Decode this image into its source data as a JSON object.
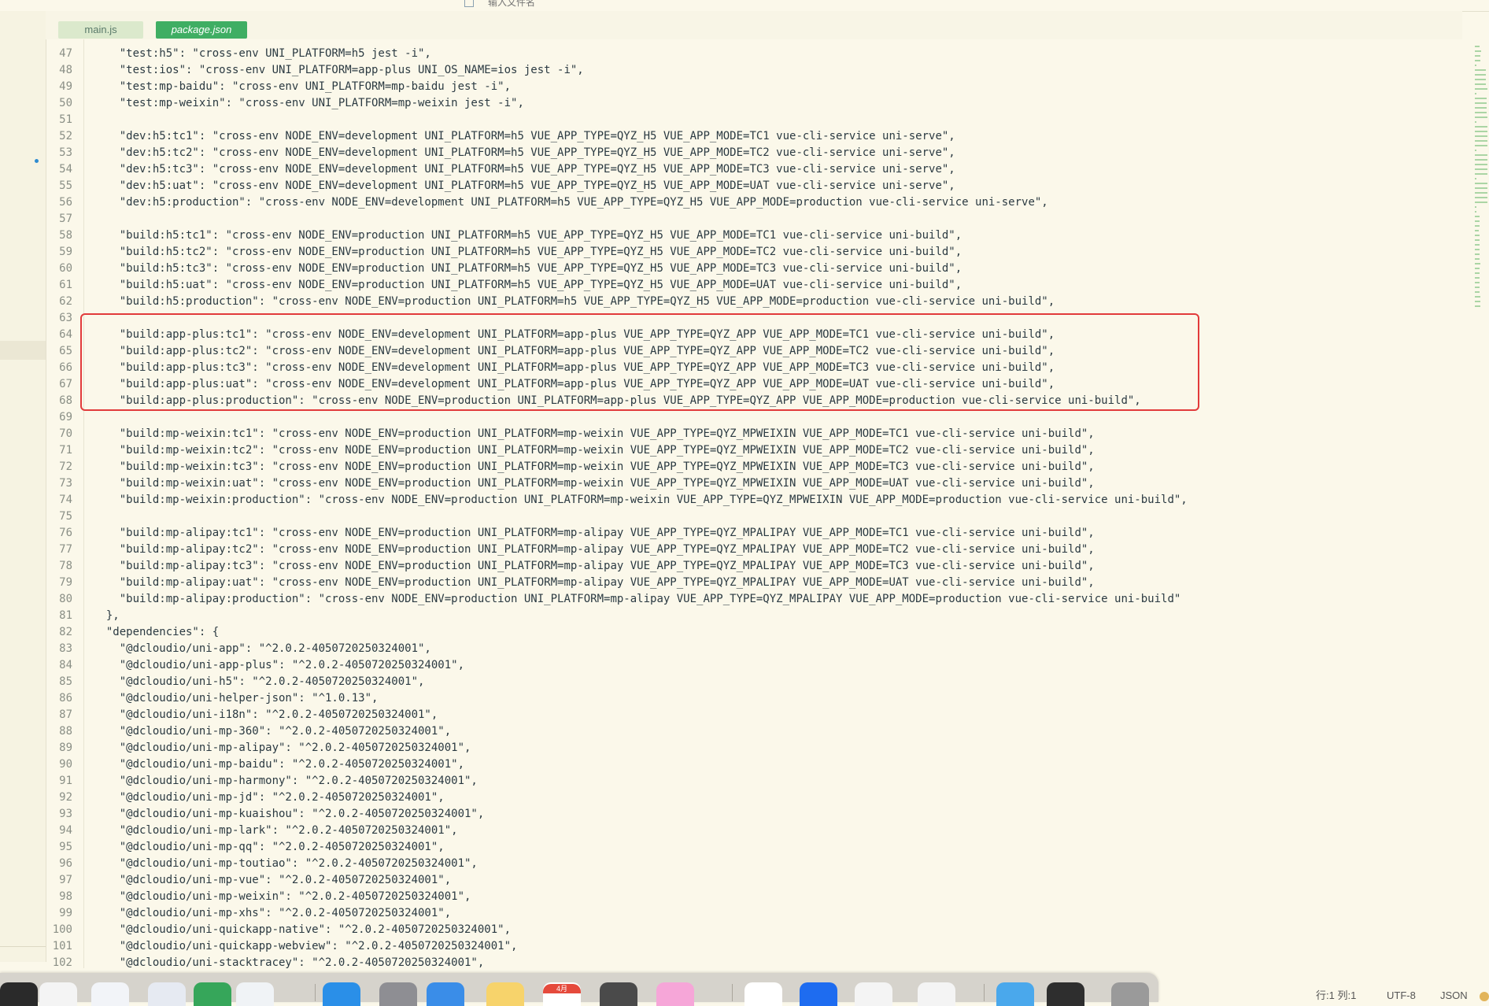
{
  "search": {
    "placeholder": "输入文件名"
  },
  "tabs": [
    {
      "label": "main.js",
      "active": false
    },
    {
      "label": "package.json",
      "active": true
    }
  ],
  "code_lines": [
    {
      "n": "47",
      "text": "    \"test:h5\": \"cross-env UNI_PLATFORM=h5 jest -i\","
    },
    {
      "n": "48",
      "text": "    \"test:ios\": \"cross-env UNI_PLATFORM=app-plus UNI_OS_NAME=ios jest -i\","
    },
    {
      "n": "49",
      "text": "    \"test:mp-baidu\": \"cross-env UNI_PLATFORM=mp-baidu jest -i\","
    },
    {
      "n": "50",
      "text": "    \"test:mp-weixin\": \"cross-env UNI_PLATFORM=mp-weixin jest -i\","
    },
    {
      "n": "51",
      "text": ""
    },
    {
      "n": "52",
      "text": "    \"dev:h5:tc1\": \"cross-env NODE_ENV=development UNI_PLATFORM=h5 VUE_APP_TYPE=QYZ_H5 VUE_APP_MODE=TC1 vue-cli-service uni-serve\","
    },
    {
      "n": "53",
      "text": "    \"dev:h5:tc2\": \"cross-env NODE_ENV=development UNI_PLATFORM=h5 VUE_APP_TYPE=QYZ_H5 VUE_APP_MODE=TC2 vue-cli-service uni-serve\","
    },
    {
      "n": "54",
      "text": "    \"dev:h5:tc3\": \"cross-env NODE_ENV=development UNI_PLATFORM=h5 VUE_APP_TYPE=QYZ_H5 VUE_APP_MODE=TC3 vue-cli-service uni-serve\","
    },
    {
      "n": "55",
      "text": "    \"dev:h5:uat\": \"cross-env NODE_ENV=development UNI_PLATFORM=h5 VUE_APP_TYPE=QYZ_H5 VUE_APP_MODE=UAT vue-cli-service uni-serve\","
    },
    {
      "n": "56",
      "text": "    \"dev:h5:production\": \"cross-env NODE_ENV=development UNI_PLATFORM=h5 VUE_APP_TYPE=QYZ_H5 VUE_APP_MODE=production vue-cli-service uni-serve\","
    },
    {
      "n": "57",
      "text": ""
    },
    {
      "n": "58",
      "text": "    \"build:h5:tc1\": \"cross-env NODE_ENV=production UNI_PLATFORM=h5 VUE_APP_TYPE=QYZ_H5 VUE_APP_MODE=TC1 vue-cli-service uni-build\","
    },
    {
      "n": "59",
      "text": "    \"build:h5:tc2\": \"cross-env NODE_ENV=production UNI_PLATFORM=h5 VUE_APP_TYPE=QYZ_H5 VUE_APP_MODE=TC2 vue-cli-service uni-build\","
    },
    {
      "n": "60",
      "text": "    \"build:h5:tc3\": \"cross-env NODE_ENV=production UNI_PLATFORM=h5 VUE_APP_TYPE=QYZ_H5 VUE_APP_MODE=TC3 vue-cli-service uni-build\","
    },
    {
      "n": "61",
      "text": "    \"build:h5:uat\": \"cross-env NODE_ENV=production UNI_PLATFORM=h5 VUE_APP_TYPE=QYZ_H5 VUE_APP_MODE=UAT vue-cli-service uni-build\","
    },
    {
      "n": "62",
      "text": "    \"build:h5:production\": \"cross-env NODE_ENV=production UNI_PLATFORM=h5 VUE_APP_TYPE=QYZ_H5 VUE_APP_MODE=production vue-cli-service uni-build\","
    },
    {
      "n": "63",
      "text": ""
    },
    {
      "n": "64",
      "text": "    \"build:app-plus:tc1\": \"cross-env NODE_ENV=development UNI_PLATFORM=app-plus VUE_APP_TYPE=QYZ_APP VUE_APP_MODE=TC1 vue-cli-service uni-build\","
    },
    {
      "n": "65",
      "text": "    \"build:app-plus:tc2\": \"cross-env NODE_ENV=development UNI_PLATFORM=app-plus VUE_APP_TYPE=QYZ_APP VUE_APP_MODE=TC2 vue-cli-service uni-build\","
    },
    {
      "n": "66",
      "text": "    \"build:app-plus:tc3\": \"cross-env NODE_ENV=development UNI_PLATFORM=app-plus VUE_APP_TYPE=QYZ_APP VUE_APP_MODE=TC3 vue-cli-service uni-build\","
    },
    {
      "n": "67",
      "text": "    \"build:app-plus:uat\": \"cross-env NODE_ENV=development UNI_PLATFORM=app-plus VUE_APP_TYPE=QYZ_APP VUE_APP_MODE=UAT vue-cli-service uni-build\","
    },
    {
      "n": "68",
      "text": "    \"build:app-plus:production\": \"cross-env NODE_ENV=production UNI_PLATFORM=app-plus VUE_APP_TYPE=QYZ_APP VUE_APP_MODE=production vue-cli-service uni-build\","
    },
    {
      "n": "69",
      "text": ""
    },
    {
      "n": "70",
      "text": "    \"build:mp-weixin:tc1\": \"cross-env NODE_ENV=production UNI_PLATFORM=mp-weixin VUE_APP_TYPE=QYZ_MPWEIXIN VUE_APP_MODE=TC1 vue-cli-service uni-build\","
    },
    {
      "n": "71",
      "text": "    \"build:mp-weixin:tc2\": \"cross-env NODE_ENV=production UNI_PLATFORM=mp-weixin VUE_APP_TYPE=QYZ_MPWEIXIN VUE_APP_MODE=TC2 vue-cli-service uni-build\","
    },
    {
      "n": "72",
      "text": "    \"build:mp-weixin:tc3\": \"cross-env NODE_ENV=production UNI_PLATFORM=mp-weixin VUE_APP_TYPE=QYZ_MPWEIXIN VUE_APP_MODE=TC3 vue-cli-service uni-build\","
    },
    {
      "n": "73",
      "text": "    \"build:mp-weixin:uat\": \"cross-env NODE_ENV=production UNI_PLATFORM=mp-weixin VUE_APP_TYPE=QYZ_MPWEIXIN VUE_APP_MODE=UAT vue-cli-service uni-build\","
    },
    {
      "n": "74",
      "text": "    \"build:mp-weixin:production\": \"cross-env NODE_ENV=production UNI_PLATFORM=mp-weixin VUE_APP_TYPE=QYZ_MPWEIXIN VUE_APP_MODE=production vue-cli-service uni-build\","
    },
    {
      "n": "75",
      "text": ""
    },
    {
      "n": "76",
      "text": "    \"build:mp-alipay:tc1\": \"cross-env NODE_ENV=production UNI_PLATFORM=mp-alipay VUE_APP_TYPE=QYZ_MPALIPAY VUE_APP_MODE=TC1 vue-cli-service uni-build\","
    },
    {
      "n": "77",
      "text": "    \"build:mp-alipay:tc2\": \"cross-env NODE_ENV=production UNI_PLATFORM=mp-alipay VUE_APP_TYPE=QYZ_MPALIPAY VUE_APP_MODE=TC2 vue-cli-service uni-build\","
    },
    {
      "n": "78",
      "text": "    \"build:mp-alipay:tc3\": \"cross-env NODE_ENV=production UNI_PLATFORM=mp-alipay VUE_APP_TYPE=QYZ_MPALIPAY VUE_APP_MODE=TC3 vue-cli-service uni-build\","
    },
    {
      "n": "79",
      "text": "    \"build:mp-alipay:uat\": \"cross-env NODE_ENV=production UNI_PLATFORM=mp-alipay VUE_APP_TYPE=QYZ_MPALIPAY VUE_APP_MODE=UAT vue-cli-service uni-build\","
    },
    {
      "n": "80",
      "text": "    \"build:mp-alipay:production\": \"cross-env NODE_ENV=production UNI_PLATFORM=mp-alipay VUE_APP_TYPE=QYZ_MPALIPAY VUE_APP_MODE=production vue-cli-service uni-build\""
    },
    {
      "n": "81",
      "text": "  },"
    },
    {
      "n": "82",
      "text": "  \"dependencies\": {"
    },
    {
      "n": "83",
      "text": "    \"@dcloudio/uni-app\": \"^2.0.2-4050720250324001\","
    },
    {
      "n": "84",
      "text": "    \"@dcloudio/uni-app-plus\": \"^2.0.2-4050720250324001\","
    },
    {
      "n": "85",
      "text": "    \"@dcloudio/uni-h5\": \"^2.0.2-4050720250324001\","
    },
    {
      "n": "86",
      "text": "    \"@dcloudio/uni-helper-json\": \"^1.0.13\","
    },
    {
      "n": "87",
      "text": "    \"@dcloudio/uni-i18n\": \"^2.0.2-4050720250324001\","
    },
    {
      "n": "88",
      "text": "    \"@dcloudio/uni-mp-360\": \"^2.0.2-4050720250324001\","
    },
    {
      "n": "89",
      "text": "    \"@dcloudio/uni-mp-alipay\": \"^2.0.2-4050720250324001\","
    },
    {
      "n": "90",
      "text": "    \"@dcloudio/uni-mp-baidu\": \"^2.0.2-4050720250324001\","
    },
    {
      "n": "91",
      "text": "    \"@dcloudio/uni-mp-harmony\": \"^2.0.2-4050720250324001\","
    },
    {
      "n": "92",
      "text": "    \"@dcloudio/uni-mp-jd\": \"^2.0.2-4050720250324001\","
    },
    {
      "n": "93",
      "text": "    \"@dcloudio/uni-mp-kuaishou\": \"^2.0.2-4050720250324001\","
    },
    {
      "n": "94",
      "text": "    \"@dcloudio/uni-mp-lark\": \"^2.0.2-4050720250324001\","
    },
    {
      "n": "95",
      "text": "    \"@dcloudio/uni-mp-qq\": \"^2.0.2-4050720250324001\","
    },
    {
      "n": "96",
      "text": "    \"@dcloudio/uni-mp-toutiao\": \"^2.0.2-4050720250324001\","
    },
    {
      "n": "97",
      "text": "    \"@dcloudio/uni-mp-vue\": \"^2.0.2-4050720250324001\","
    },
    {
      "n": "98",
      "text": "    \"@dcloudio/uni-mp-weixin\": \"^2.0.2-4050720250324001\","
    },
    {
      "n": "99",
      "text": "    \"@dcloudio/uni-mp-xhs\": \"^2.0.2-4050720250324001\","
    },
    {
      "n": "100",
      "text": "    \"@dcloudio/uni-quickapp-native\": \"^2.0.2-4050720250324001\","
    },
    {
      "n": "101",
      "text": "    \"@dcloudio/uni-quickapp-webview\": \"^2.0.2-4050720250324001\","
    },
    {
      "n": "102",
      "text": "    \"@dcloudio/uni-stacktracey\": \"^2.0.2-4050720250324001\","
    }
  ],
  "dock": {
    "calendar_month": "4月",
    "icons": [
      {
        "name": "terminal-icon",
        "color": "#2a2a2a"
      },
      {
        "name": "chatgpt-icon",
        "color": "#f4f4f4"
      },
      {
        "name": "vscode-icon",
        "color": "#f2f4f8"
      },
      {
        "name": "hbuilder-icon",
        "color": "#e6eaf2"
      },
      {
        "name": "h-app-icon",
        "color": "#36a65a"
      },
      {
        "name": "safari-icon",
        "color": "#f0f3f6"
      },
      {
        "name": "appstore-icon",
        "color": "#2a8fe8"
      },
      {
        "name": "settings-icon",
        "color": "#8e8e93"
      },
      {
        "name": "xcode-icon",
        "color": "#3a8de8"
      },
      {
        "name": "notes-icon",
        "color": "#f7d36b"
      },
      {
        "name": "calendar-icon",
        "color": "#ffffff"
      },
      {
        "name": "gamepad-icon",
        "color": "#4a4a4a"
      },
      {
        "name": "cat-app-icon",
        "color": "#f6a6d8"
      },
      {
        "name": "wps-icon",
        "color": "#ffffff"
      },
      {
        "name": "browser-icon",
        "color": "#1e6cf0"
      },
      {
        "name": "instruments-icon",
        "color": "#f4f4f4"
      },
      {
        "name": "textedit-icon",
        "color": "#f4f4f4"
      },
      {
        "name": "folder-icon",
        "color": "#4aa8ec"
      },
      {
        "name": "window-icon",
        "color": "#2e2e2e"
      },
      {
        "name": "trash-icon",
        "color": "#9a9a9a"
      }
    ]
  },
  "status": {
    "position": "行:1   列:1",
    "encoding": "UTF-8",
    "language": "JSON"
  }
}
